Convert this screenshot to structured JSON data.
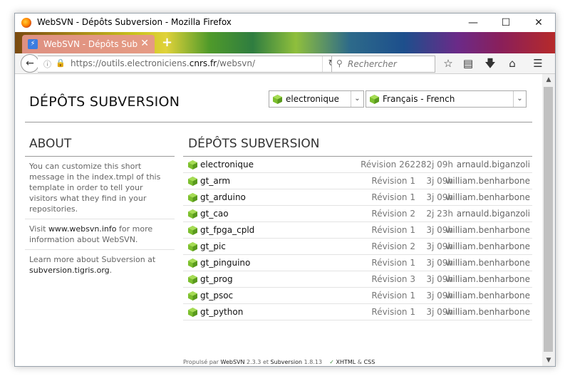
{
  "window": {
    "title": "WebSVN - Dépôts Subversion - Mozilla Firefox",
    "minimize": "—",
    "maximize": "☐",
    "close": "✕"
  },
  "tab": {
    "label": "WebSVN - Dépôts Subvers...",
    "close": "✕",
    "new_tab": "+"
  },
  "nav": {
    "url_prefix": "https://outils.electroniciens.",
    "url_domain": "cnrs.fr",
    "url_suffix": "/websvn/",
    "search_placeholder": "Rechercher"
  },
  "page": {
    "title": "DÉPÔTS SUBVERSION",
    "repo_select": "electronique",
    "lang_select": "Français - French"
  },
  "about": {
    "heading": "ABOUT",
    "p1": "You can customize this short message in the index.tmpl of this template in order to tell your visitors what they find in your repositories.",
    "p2_prefix": "Visit ",
    "p2_link": "www.websvn.info",
    "p2_suffix": " for more information about WebSVN.",
    "p3_prefix": "Learn more about Subversion at ",
    "p3_link": "subversion.tigris.org",
    "p3_suffix": "."
  },
  "repos": {
    "heading": "DÉPÔTS SUBVERSION",
    "rows": [
      {
        "name": "electronique",
        "rev": "Révision 262",
        "age": "282j 09h",
        "author": "arnauld.biganzoli"
      },
      {
        "name": "gt_arm",
        "rev": "Révision 1",
        "age": "3j 09h",
        "author": "william.benharbone"
      },
      {
        "name": "gt_arduino",
        "rev": "Révision 1",
        "age": "3j 09h",
        "author": "william.benharbone"
      },
      {
        "name": "gt_cao",
        "rev": "Révision 2",
        "age": "2j 23h",
        "author": "arnauld.biganzoli"
      },
      {
        "name": "gt_fpga_cpld",
        "rev": "Révision 1",
        "age": "3j 09h",
        "author": "william.benharbone"
      },
      {
        "name": "gt_pic",
        "rev": "Révision 2",
        "age": "3j 09h",
        "author": "william.benharbone"
      },
      {
        "name": "gt_pinguino",
        "rev": "Révision 1",
        "age": "3j 09h",
        "author": "william.benharbone"
      },
      {
        "name": "gt_prog",
        "rev": "Révision 3",
        "age": "3j 09h",
        "author": "william.benharbone"
      },
      {
        "name": "gt_psoc",
        "rev": "Révision 1",
        "age": "3j 09h",
        "author": "william.benharbone"
      },
      {
        "name": "gt_python",
        "rev": "Révision 1",
        "age": "3j 09h",
        "author": "william.benharbone"
      }
    ]
  },
  "footer": {
    "powered": "Propulsé par ",
    "websvn": "WebSVN",
    "websvn_ver": " 2.3.3 et ",
    "subversion": "Subversion",
    "subversion_ver": " 1.8.13",
    "check": "✓",
    "xhtml": "XHTML",
    "amp": " & ",
    "css": "CSS"
  },
  "colors": {
    "cube_green": "#7cbf2e",
    "accent_tab": "#e6968c"
  },
  "icons": [
    "firefox-icon",
    "back-arrow-icon",
    "info-icon",
    "lock-icon",
    "reload-icon",
    "search-icon",
    "star-icon",
    "reader-icon",
    "download-icon",
    "home-icon",
    "menu-icon",
    "repo-cube-icon"
  ]
}
